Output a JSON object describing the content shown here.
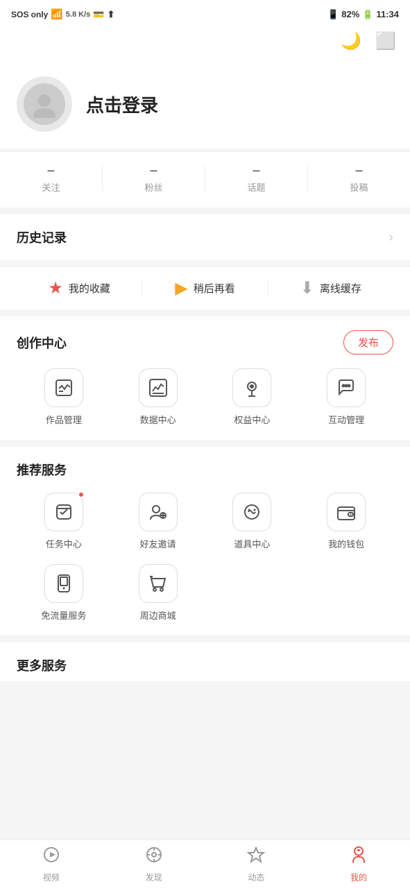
{
  "statusBar": {
    "left": "SOS only",
    "signal": "📶",
    "speed": "5.8 K/s",
    "battery_pct": "82%",
    "time": "11:34"
  },
  "topActions": {
    "night_mode_icon": "night-mode-icon",
    "scan_icon": "scan-icon"
  },
  "profile": {
    "login_text": "点击登录",
    "avatar_alt": "用户头像"
  },
  "stats": [
    {
      "num": "–",
      "label": "关注"
    },
    {
      "num": "–",
      "label": "粉丝"
    },
    {
      "num": "–",
      "label": "话题"
    },
    {
      "num": "–",
      "label": "投稿"
    }
  ],
  "history": {
    "title": "历史记录"
  },
  "quickLinks": [
    {
      "icon": "⭐",
      "label": "我的收藏",
      "color": "#e8534a"
    },
    {
      "icon": "▶",
      "label": "稍后再看",
      "color": "#f5a623"
    },
    {
      "icon": "⬇",
      "label": "离线缓存",
      "color": "#aaa"
    }
  ],
  "creation": {
    "title": "创作中心",
    "publishBtn": "发布",
    "items": [
      {
        "label": "作品管理",
        "icon": "☑"
      },
      {
        "label": "数据中心",
        "icon": "📈"
      },
      {
        "label": "权益中心",
        "icon": "🎧"
      },
      {
        "label": "互动管理",
        "icon": "💬"
      }
    ]
  },
  "services": {
    "title": "推荐服务",
    "items": [
      {
        "label": "任务中心",
        "icon": "🧩",
        "badge": true
      },
      {
        "label": "好友邀请",
        "icon": "👥",
        "badge": false
      },
      {
        "label": "道具中心",
        "icon": "😊",
        "badge": false
      },
      {
        "label": "我的钱包",
        "icon": "👛",
        "badge": false
      },
      {
        "label": "免流量服务",
        "icon": "📱",
        "badge": false
      },
      {
        "label": "周边商城",
        "icon": "🏪",
        "badge": false
      }
    ]
  },
  "moreSection": {
    "title": "更多服务"
  },
  "bottomNav": [
    {
      "label": "视频",
      "icon": "▶",
      "active": false
    },
    {
      "label": "发现",
      "icon": "🔭",
      "active": false
    },
    {
      "label": "动态",
      "icon": "⭐",
      "active": false
    },
    {
      "label": "我的",
      "icon": "💝",
      "active": true
    }
  ]
}
